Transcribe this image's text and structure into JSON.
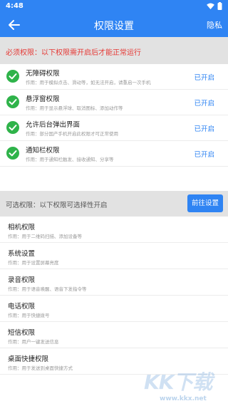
{
  "status_bar": {
    "time": "4:48",
    "icons": [
      "wifi-icon",
      "battery-icon"
    ]
  },
  "app_bar": {
    "title": "权限设置",
    "privacy_label": "隐私",
    "back_icon": "arrow-left-icon"
  },
  "required": {
    "banner_text": "必须权限：以下权限需开启后才能正常运行",
    "items": [
      {
        "name": "无障碍权限",
        "desc": "作用：用于模拟点击、滑动等，如无法开启，请重启一次手机",
        "status": "已开启"
      },
      {
        "name": "悬浮窗权限",
        "desc": "作用：用于显示悬浮球、取消图标、添加动作等",
        "status": "已开启"
      },
      {
        "name": "允许后台弹出界面",
        "desc": "作用：部分国产手机开启此权限才可正常使用",
        "status": "已开启"
      },
      {
        "name": "通知栏权限",
        "desc": "作用：用于通知栏触发、接收通知、分享等",
        "status": "已开启"
      }
    ]
  },
  "optional": {
    "banner_text": "可选权限：以下权限可选择性开启",
    "goto_label": "前往设置",
    "items": [
      {
        "name": "相机权限",
        "desc": "作用：用于二维码扫描、添加设备等"
      },
      {
        "name": "系统设置",
        "desc": "作用：用于设置屏幕亮度"
      },
      {
        "name": "录音权限",
        "desc": "作用：用于语音唤醒、语音下发指令等"
      },
      {
        "name": "电话权限",
        "desc": "作用：用于快捷拨号"
      },
      {
        "name": "短信权限",
        "desc": "作用：用户一键发送信息"
      },
      {
        "name": "桌面快捷权限",
        "desc": "作用：用于发送到桌面快捷方式"
      }
    ]
  },
  "watermark": {
    "brand": "KK下载",
    "url": "www.kkx.net"
  },
  "colors": {
    "primary": "#2f84f3",
    "success": "#2fb34a",
    "warning_text": "#e53935",
    "banner_bg": "#e2e2e2"
  }
}
